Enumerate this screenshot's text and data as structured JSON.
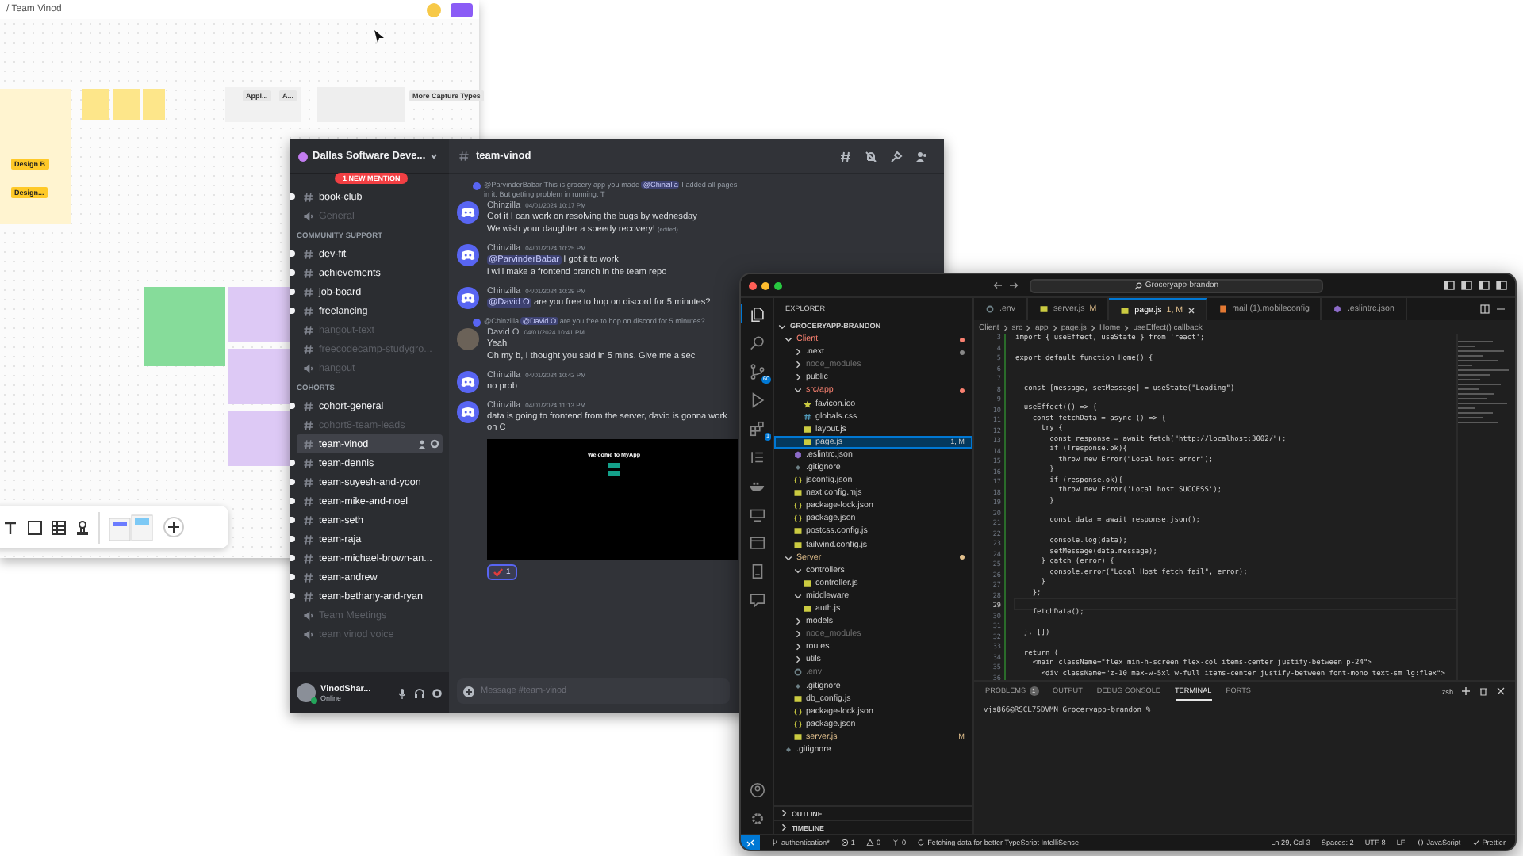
{
  "whiteboard": {
    "breadcrumb": "/ Team Vinod",
    "labels": [
      {
        "text": "Design B"
      },
      {
        "text": "Design..."
      },
      {
        "text": "Appl..."
      },
      {
        "text": "A..."
      },
      {
        "text": "More Capture Types"
      }
    ]
  },
  "discord": {
    "server_name": "Dallas Software Deve...",
    "mention_badge": "1 NEW MENTION",
    "sections": [
      {
        "channels": [
          {
            "kind": "text",
            "name": "book-club",
            "unread": true,
            "muted": false,
            "selected": false
          },
          {
            "kind": "voice",
            "name": "General",
            "unread": false,
            "muted": true,
            "selected": false
          }
        ]
      },
      {
        "title": "COMMUNITY SUPPORT",
        "channels": [
          {
            "kind": "text",
            "name": "dev-fit",
            "unread": true,
            "muted": false,
            "selected": false
          },
          {
            "kind": "text",
            "name": "achievements",
            "unread": true,
            "muted": false,
            "selected": false
          },
          {
            "kind": "text",
            "name": "job-board",
            "unread": true,
            "muted": false,
            "selected": false
          },
          {
            "kind": "text",
            "name": "freelancing",
            "unread": true,
            "muted": false,
            "selected": false
          },
          {
            "kind": "text",
            "name": "hangout-text",
            "unread": false,
            "muted": true,
            "selected": false
          },
          {
            "kind": "text",
            "name": "freecodecamp-studygro...",
            "unread": false,
            "muted": true,
            "selected": false
          },
          {
            "kind": "voice",
            "name": "hangout",
            "unread": false,
            "muted": true,
            "selected": false
          }
        ]
      },
      {
        "title": "COHORTS",
        "channels": [
          {
            "kind": "text",
            "name": "cohort-general",
            "unread": true,
            "muted": false,
            "selected": false
          },
          {
            "kind": "text",
            "name": "cohort8-team-leads",
            "unread": false,
            "muted": true,
            "selected": false
          },
          {
            "kind": "text",
            "name": "team-vinod",
            "unread": false,
            "muted": false,
            "selected": true
          },
          {
            "kind": "text",
            "name": "team-dennis",
            "unread": true,
            "muted": false,
            "selected": false
          },
          {
            "kind": "text",
            "name": "team-suyesh-and-yoon",
            "unread": true,
            "muted": false,
            "selected": false
          },
          {
            "kind": "text",
            "name": "team-mike-and-noel",
            "unread": true,
            "muted": false,
            "selected": false
          },
          {
            "kind": "text",
            "name": "team-seth",
            "unread": true,
            "muted": false,
            "selected": false
          },
          {
            "kind": "text",
            "name": "team-raja",
            "unread": true,
            "muted": false,
            "selected": false
          },
          {
            "kind": "text",
            "name": "team-michael-brown-an...",
            "unread": true,
            "muted": false,
            "selected": false
          },
          {
            "kind": "text",
            "name": "team-andrew",
            "unread": true,
            "muted": false,
            "selected": false
          },
          {
            "kind": "text",
            "name": "team-bethany-and-ryan",
            "unread": true,
            "muted": false,
            "selected": false
          },
          {
            "kind": "voice",
            "name": "Team Meetings",
            "unread": false,
            "muted": true,
            "selected": false
          },
          {
            "kind": "voice",
            "name": "team vinod voice",
            "unread": false,
            "muted": true,
            "selected": false
          }
        ]
      }
    ],
    "user": {
      "name": "VinodShar...",
      "status": "Online"
    },
    "channel_title": "team-vinod",
    "messages": [
      {
        "kind": "bot",
        "author": "Chinzilla",
        "time": "04/01/2024 10:17 PM",
        "reply": [
          {
            "text": "@ParvinderBabar",
            "kind": "name"
          },
          {
            "text": "This is grocery app you made",
            "kind": "plain"
          },
          {
            "text": "@Chinzilla",
            "kind": "mention"
          },
          {
            "text": "I added all pages in it. But getting problem in running. T",
            "kind": "plain"
          }
        ],
        "lines": [
          [
            {
              "text": "Got it I can work on resolving the bugs by wednesday",
              "kind": "plain"
            }
          ],
          [
            {
              "text": "We wish your daughter a speedy recovery!",
              "kind": "plain"
            },
            {
              "text": "(edited)",
              "kind": "edited"
            }
          ]
        ]
      },
      {
        "kind": "bot",
        "author": "Chinzilla",
        "time": "04/01/2024 10:25 PM",
        "lines": [
          [
            {
              "text": "@ParvinderBabar",
              "kind": "mention"
            },
            {
              "text": "I got it to work",
              "kind": "plain"
            }
          ],
          [
            {
              "text": "i will make a frontend branch in the team repo",
              "kind": "plain"
            }
          ]
        ]
      },
      {
        "kind": "bot",
        "author": "Chinzilla",
        "time": "04/01/2024 10:39 PM",
        "lines": [
          [
            {
              "text": "@David O",
              "kind": "mention"
            },
            {
              "text": "are you free to hop on discord for 5 minutes?",
              "kind": "plain"
            }
          ]
        ]
      },
      {
        "kind": "photo",
        "author": "David O",
        "time": "04/01/2024 10:41 PM",
        "reply": [
          {
            "text": "@Chinzilla",
            "kind": "name"
          },
          {
            "text": "@David O",
            "kind": "mention"
          },
          {
            "text": "are you free to hop on discord for 5 minutes?",
            "kind": "plain"
          }
        ],
        "lines": [
          [
            {
              "text": "Yeah",
              "kind": "plain"
            }
          ],
          [
            {
              "text": "Oh my b, I thought you said in 5 mins. Give me a sec",
              "kind": "plain"
            }
          ]
        ]
      },
      {
        "kind": "bot",
        "author": "Chinzilla",
        "time": "04/01/2024 10:42 PM",
        "lines": [
          [
            {
              "text": "no prob",
              "kind": "plain"
            }
          ]
        ]
      },
      {
        "kind": "bot",
        "author": "Chinzilla",
        "time": "04/01/2024 11:13 PM",
        "lines": [
          [
            {
              "text": "data is going to frontend from the server, david is gonna work on C",
              "kind": "plain"
            }
          ]
        ],
        "embed": {
          "title": "Welcome to MyApp"
        },
        "reaction": {
          "count": "1"
        }
      }
    ],
    "composer": {
      "placeholder": "Message #team-vinod"
    }
  },
  "vscode": {
    "search": "Groceryapp-brandon",
    "activity": [
      {
        "kind": "files",
        "selected": true
      },
      {
        "kind": "search",
        "selected": false
      },
      {
        "kind": "scm",
        "selected": false,
        "badge": "60"
      },
      {
        "kind": "debug",
        "selected": false
      },
      {
        "kind": "extensions",
        "selected": false,
        "badge": "1"
      },
      {
        "kind": "list",
        "selected": false
      },
      {
        "kind": "docker",
        "selected": false
      },
      {
        "kind": "remote",
        "selected": false
      },
      {
        "kind": "window",
        "selected": false
      },
      {
        "kind": "book",
        "selected": false
      },
      {
        "kind": "chat",
        "selected": false
      }
    ],
    "explorer": {
      "title": "EXPLORER",
      "root": "GROCERYAPP-BRANDON",
      "tree": [
        {
          "name": "Client",
          "kind": "folder",
          "expanded": true,
          "selected": false,
          "errors": true,
          "dot": true,
          "children": [
            {
              "name": ".next",
              "kind": "folder",
              "expanded": false,
              "selected": false,
              "dot": true
            },
            {
              "name": "node_modules",
              "kind": "folder",
              "expanded": false,
              "selected": false,
              "ignored": true
            },
            {
              "name": "public",
              "kind": "folder",
              "expanded": false,
              "selected": false
            },
            {
              "name": "src/app",
              "kind": "folder",
              "expanded": true,
              "selected": false,
              "errors": true,
              "dot": true,
              "children": [
                {
                  "name": "favicon.ico",
                  "kind": "ico",
                  "selected": false
                },
                {
                  "name": "globals.css",
                  "kind": "css",
                  "selected": false
                },
                {
                  "name": "layout.js",
                  "kind": "js",
                  "selected": false
                },
                {
                  "name": "page.js",
                  "kind": "js",
                  "selected": true,
                  "badge": "1, M"
                }
              ]
            },
            {
              "name": ".eslintrc.json",
              "kind": "eslint",
              "selected": false
            },
            {
              "name": ".gitignore",
              "kind": "git",
              "selected": false
            },
            {
              "name": "jsconfig.json",
              "kind": "json",
              "selected": false
            },
            {
              "name": "next.config.mjs",
              "kind": "js",
              "selected": false
            },
            {
              "name": "package-lock.json",
              "kind": "json",
              "selected": false
            },
            {
              "name": "package.json",
              "kind": "json",
              "selected": false
            },
            {
              "name": "postcss.config.js",
              "kind": "js",
              "selected": false
            },
            {
              "name": "tailwind.config.js",
              "kind": "js",
              "selected": false
            }
          ]
        },
        {
          "name": "Server",
          "kind": "folder",
          "expanded": true,
          "selected": false,
          "modified": true,
          "dot": true,
          "children": [
            {
              "name": "controllers",
              "kind": "folder",
              "expanded": true,
              "selected": false,
              "children": [
                {
                  "name": "controller.js",
                  "kind": "js",
                  "selected": false
                }
              ]
            },
            {
              "name": "middleware",
              "kind": "folder",
              "expanded": true,
              "selected": false,
              "children": [
                {
                  "name": "auth.js",
                  "kind": "js",
                  "selected": false
                }
              ]
            },
            {
              "name": "models",
              "kind": "folder",
              "expanded": false,
              "selected": false
            },
            {
              "name": "node_modules",
              "kind": "folder",
              "expanded": false,
              "selected": false,
              "ignored": true
            },
            {
              "name": "routes",
              "kind": "folder",
              "expanded": false,
              "selected": false
            },
            {
              "name": "utils",
              "kind": "folder",
              "expanded": false,
              "selected": false
            },
            {
              "name": ".env",
              "kind": "env",
              "selected": false,
              "ignored": true
            },
            {
              "name": ".gitignore",
              "kind": "git",
              "selected": false
            },
            {
              "name": "db_config.js",
              "kind": "js",
              "selected": false
            },
            {
              "name": "package-lock.json",
              "kind": "json",
              "selected": false
            },
            {
              "name": "package.json",
              "kind": "json",
              "selected": false
            },
            {
              "name": "server.js",
              "kind": "js",
              "selected": false,
              "modified": true,
              "badge": "M"
            }
          ]
        },
        {
          "name": ".gitignore",
          "kind": "git",
          "selected": false
        }
      ],
      "sections": [
        "OUTLINE",
        "TIMELINE"
      ]
    },
    "tabs": [
      {
        "label": ".env",
        "kind": "env",
        "selected": false
      },
      {
        "label": "server.js",
        "kind": "js",
        "selected": false,
        "badge": "M"
      },
      {
        "label": "page.js",
        "kind": "js",
        "selected": true,
        "badge": "1, M"
      },
      {
        "label": "mail (1).mobileconfig",
        "kind": "mail",
        "selected": false
      },
      {
        "label": ".eslintrc.json",
        "kind": "eslint",
        "selected": false
      }
    ],
    "breadcrumb": [
      "Client",
      "src",
      "app",
      "page.js",
      "Home",
      "useEffect() callback"
    ],
    "code": [
      {
        "number": "3",
        "text": "import { useEffect, useState } from 'react';",
        "current": false
      },
      {
        "number": "4",
        "current": false
      },
      {
        "number": "5",
        "text": "export default function Home() {",
        "current": false
      },
      {
        "number": "6",
        "current": false
      },
      {
        "number": "7",
        "current": false
      },
      {
        "number": "8",
        "text": "  const [message, setMessage] = useState(\"Loading\")",
        "current": false
      },
      {
        "number": "9",
        "current": false
      },
      {
        "number": "10",
        "text": "  useEffect(() => {",
        "current": false
      },
      {
        "number": "11",
        "text": "    const fetchData = async () => {",
        "current": false
      },
      {
        "number": "12",
        "text": "      try {",
        "current": false
      },
      {
        "number": "13",
        "text": "        const response = await fetch(\"http://localhost:3002/\");",
        "current": false
      },
      {
        "number": "14",
        "text": "        if (!response.ok){",
        "current": false
      },
      {
        "number": "15",
        "text": "          throw new Error(\"Local host error\");",
        "current": false
      },
      {
        "number": "16",
        "text": "        }",
        "current": false
      },
      {
        "number": "17",
        "text": "        if (response.ok){",
        "current": false
      },
      {
        "number": "18",
        "text": "          throw new Error('Local host SUCCESS');",
        "current": false
      },
      {
        "number": "19",
        "text": "        }",
        "current": false
      },
      {
        "number": "20",
        "current": false
      },
      {
        "number": "21",
        "text": "        const data = await response.json();",
        "current": false
      },
      {
        "number": "22",
        "current": false
      },
      {
        "number": "23",
        "text": "        console.log(data);",
        "current": false
      },
      {
        "number": "24",
        "text": "        setMessage(data.message);",
        "current": false
      },
      {
        "number": "25",
        "text": "      } catch (error) {",
        "current": false
      },
      {
        "number": "26",
        "text": "        console.error(\"Local Host fetch fail\", error);",
        "current": false
      },
      {
        "number": "27",
        "text": "      }",
        "current": false
      },
      {
        "number": "28",
        "text": "    };",
        "current": false
      },
      {
        "number": "29",
        "current": true
      },
      {
        "number": "30",
        "text": "    fetchData();",
        "current": false
      },
      {
        "number": "31",
        "current": false
      },
      {
        "number": "32",
        "text": "  }, [])",
        "current": false
      },
      {
        "number": "33",
        "current": false
      },
      {
        "number": "34",
        "text": "  return (",
        "current": false
      },
      {
        "number": "35",
        "text": "    <main className=\"flex min-h-screen flex-col items-center justify-between p-24\">",
        "current": false
      },
      {
        "number": "36",
        "text": "      <div className=\"z-10 max-w-5xl w-full items-center justify-between font-mono text-sm lg:flex\">",
        "current": false
      }
    ],
    "panel": {
      "tabs": [
        {
          "label": "PROBLEMS",
          "badge": "1",
          "selected": false
        },
        {
          "label": "OUTPUT",
          "selected": false
        },
        {
          "label": "DEBUG CONSOLE",
          "selected": false
        },
        {
          "label": "TERMINAL",
          "selected": true
        },
        {
          "label": "PORTS",
          "selected": false
        }
      ],
      "shell": "zsh",
      "terminal_lines": [
        "vjs866@RSCL75DVMN Groceryapp-brandon %"
      ]
    },
    "status_left": [
      {
        "kind": "branch",
        "text": "authentication*"
      },
      {
        "kind": "error",
        "text": "1"
      },
      {
        "kind": "warning",
        "text": "0"
      },
      {
        "kind": "ports",
        "text": "0"
      },
      {
        "kind": "sync",
        "text": "Fetching data for better TypeScript IntelliSense"
      }
    ],
    "status_right": [
      {
        "kind": "plain",
        "text": "Ln 29, Col 3"
      },
      {
        "kind": "plain",
        "text": "Spaces: 2"
      },
      {
        "kind": "plain",
        "text": "UTF-8"
      },
      {
        "kind": "plain",
        "text": "LF"
      },
      {
        "kind": "braces",
        "text": "JavaScript"
      },
      {
        "kind": "check",
        "text": "Prettier"
      }
    ]
  }
}
